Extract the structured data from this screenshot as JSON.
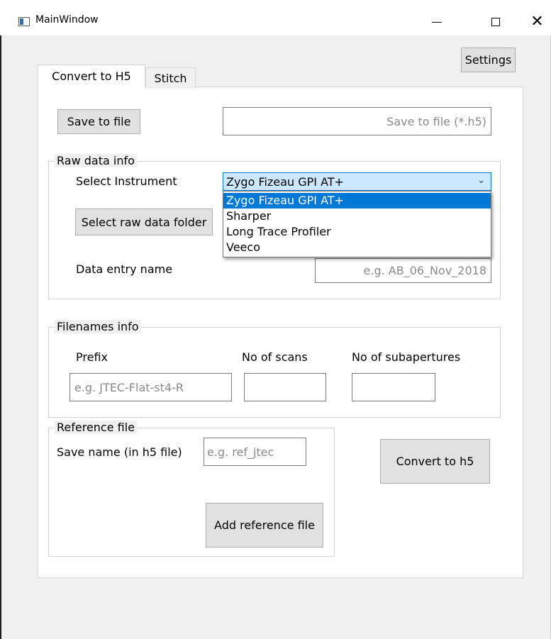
{
  "window": {
    "title": "MainWindow",
    "minimize": "—",
    "maximize": "☐",
    "close": "✕"
  },
  "header": {
    "settings_label": "Settings"
  },
  "tabs": [
    {
      "label": "Convert to H5",
      "active": true
    },
    {
      "label": "Stitch",
      "active": false
    }
  ],
  "save": {
    "button_label": "Save to file",
    "path_placeholder": "Save to file (*.h5)"
  },
  "raw_data": {
    "legend": "Raw data info",
    "select_instrument_label": "Select Instrument",
    "selected_instrument": "Zygo Fizeau GPI AT+",
    "instrument_options": [
      "Zygo Fizeau GPI AT+",
      "Sharper",
      "Long Trace Profiler",
      "Veeco"
    ],
    "select_folder_button": "Select raw data folder",
    "entry_name_label": "Data entry name",
    "entry_name_placeholder": "e.g. AB_06_Nov_2018"
  },
  "filenames": {
    "legend": "Filenames info",
    "prefix_label": "Prefix",
    "prefix_placeholder": "e.g. JTEC-Flat-st4-R",
    "scans_label": "No of scans",
    "subapertures_label": "No of subapertures"
  },
  "reference": {
    "legend": "Reference file",
    "save_name_label": "Save name (in h5 file)",
    "save_name_placeholder": "e.g. ref_jtec",
    "add_button": "Add reference file"
  },
  "convert": {
    "button_label": "Convert to h5"
  }
}
